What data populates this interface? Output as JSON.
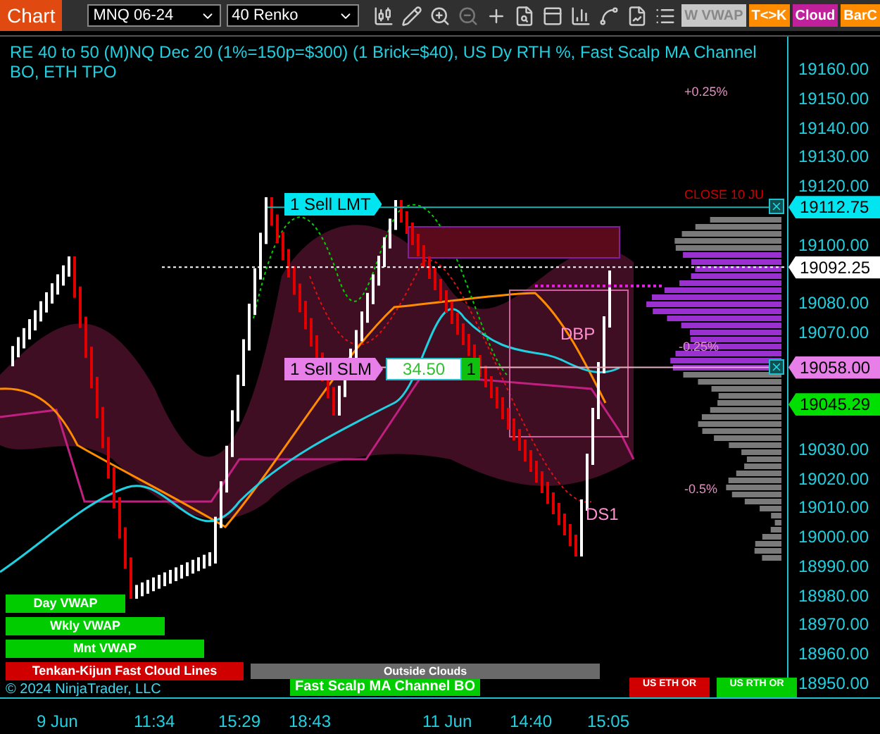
{
  "toolbar": {
    "title": "Chart",
    "instrument": "MNQ 06-24",
    "bar_type": "40 Renko",
    "buttons": [
      {
        "label": "W VWAP",
        "color": "#c8c8c8"
      },
      {
        "label": "T<>K",
        "color": "#ff8c00"
      },
      {
        "label": "Cloud",
        "color": "#c0209a"
      },
      {
        "label": "BarC",
        "color": "#ff8c00"
      }
    ]
  },
  "chart": {
    "title": "RE 40 to 50 (M)NQ Dec 20 (1%=150p=$300) (1 Brick=$40), US Dy RTH %, Fast Scalp MA Channel BO, ETH TPO",
    "annotations": [
      {
        "text": "+0.25%",
        "kind": "level"
      },
      {
        "text": "CLOSE 10 JU",
        "kind": "close"
      },
      {
        "text": "DBP",
        "kind": "pivot"
      },
      {
        "text": "-0.25%",
        "kind": "level"
      },
      {
        "text": "-0.5%",
        "kind": "level"
      },
      {
        "text": "DS1",
        "kind": "pivot"
      }
    ],
    "orders": [
      {
        "label": "1 Sell LMT",
        "color": "#00e5f0"
      },
      {
        "label": "1 Sell SLM",
        "color": "#e87ee8",
        "price": "34.50",
        "quantity": "1"
      }
    ],
    "indicator_tags": [
      {
        "label": "Day VWAP",
        "color": "#00cc00"
      },
      {
        "label": "Wkly VWAP",
        "color": "#00cc00"
      },
      {
        "label": "Mnt VWAP",
        "color": "#00cc00"
      },
      {
        "label": "Tenkan-Kijun Fast Cloud Lines",
        "color": "#d00000"
      }
    ],
    "copyright": "© 2024 NinjaTrader, LLC",
    "status_bars": [
      {
        "label": "Outside Clouds",
        "color": "#6a6a6a"
      },
      {
        "label": "Fast Scalp MA Channel BO",
        "color": "#00cc00"
      }
    ],
    "session_tags": [
      {
        "label": "US ETH OR",
        "color": "#d00000"
      },
      {
        "label": "US RTH OR",
        "color": "#00cc00"
      }
    ]
  },
  "price_axis": {
    "ticks": [
      "19160.00",
      "19150.00",
      "19140.00",
      "19130.00",
      "19120.00",
      "19100.00",
      "19080.00",
      "19070.00",
      "19030.00",
      "19020.00",
      "19010.00",
      "19000.00",
      "18990.00",
      "18980.00",
      "18970.00",
      "18960.00",
      "18950.00"
    ],
    "tags": [
      {
        "text": "19112.75",
        "color": "#00e5f0"
      },
      {
        "text": "19092.25",
        "color": "#ffffff"
      },
      {
        "text": "19058.00",
        "color": "#e87ee8"
      },
      {
        "text": "19045.29",
        "color": "#00e000"
      }
    ]
  },
  "time_axis": [
    "9 Jun",
    "11:34",
    "15:29",
    "18:43",
    "11 Jun",
    "14:40",
    "15:05"
  ]
}
